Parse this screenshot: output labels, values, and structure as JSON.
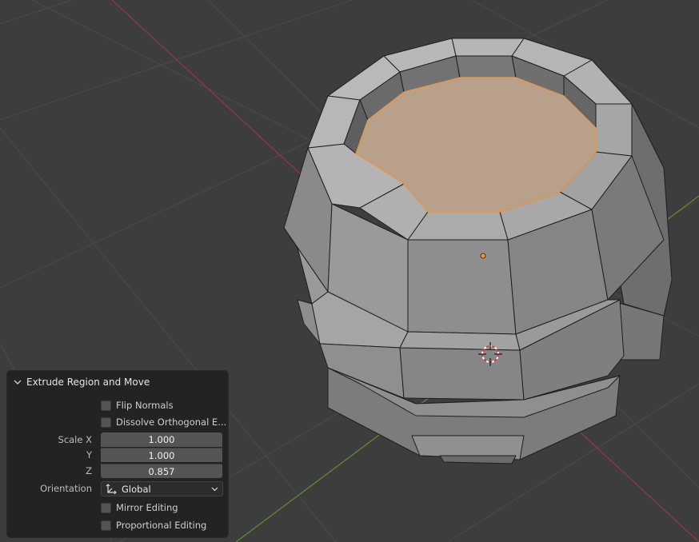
{
  "operator_panel": {
    "title": "Extrude Region and Move",
    "flip_normals": {
      "label": "Flip Normals",
      "checked": false
    },
    "dissolve_orthogonal": {
      "label": "Dissolve Orthogonal E...",
      "checked": false
    },
    "scale": {
      "x_label": "Scale X",
      "x_value": "1.000",
      "y_label": "Y",
      "y_value": "1.000",
      "z_label": "Z",
      "z_value": "0.857"
    },
    "orientation": {
      "label": "Orientation",
      "value": "Global"
    },
    "mirror_editing": {
      "label": "Mirror Editing",
      "checked": false
    },
    "proportional_editing": {
      "label": "Proportional Editing",
      "checked": false
    }
  },
  "viewport": {
    "background_color": "#3d3d3d",
    "x_axis_color": "#8c3a45",
    "y_axis_color": "#5f8a2e",
    "selected_face_color": "#b8a08a",
    "selection_outline_color": "#f0973a"
  }
}
